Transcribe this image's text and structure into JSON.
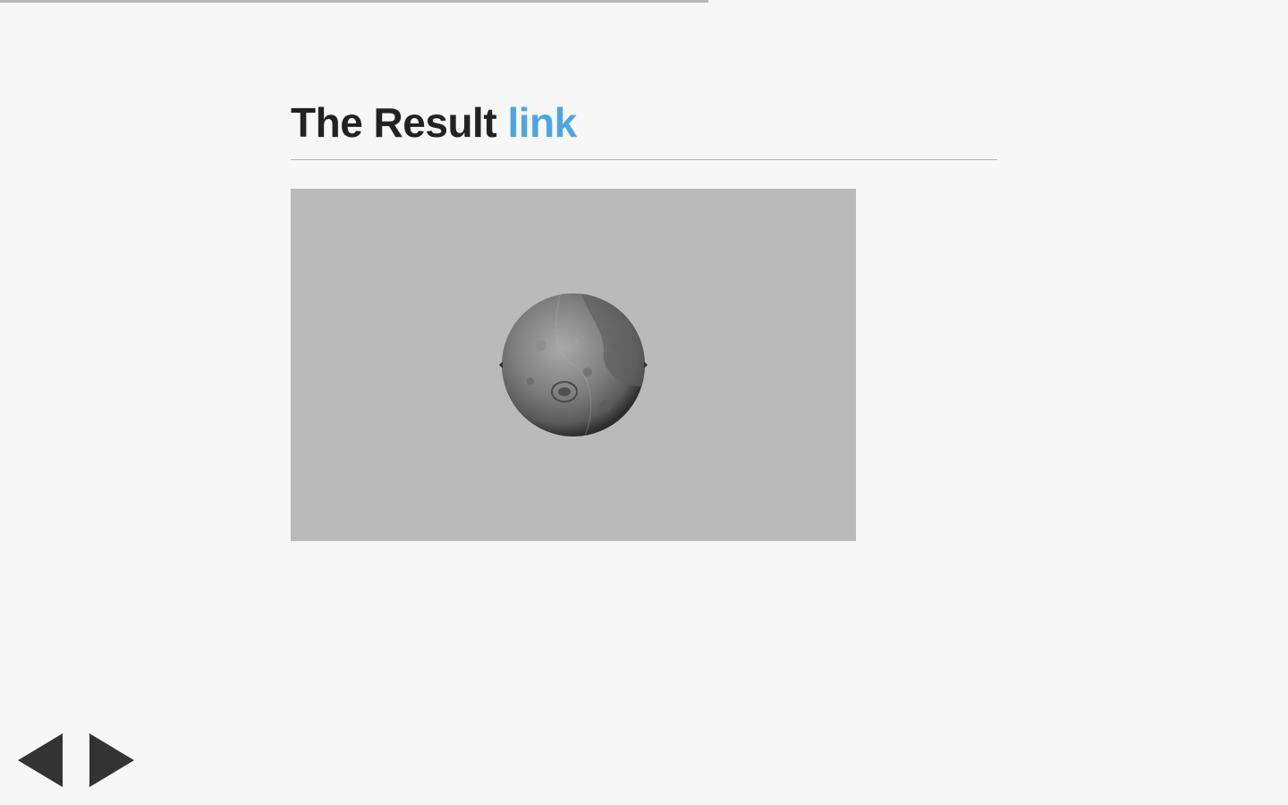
{
  "progress": {
    "fraction": 0.55
  },
  "slide": {
    "title_text": "The Result ",
    "title_link": "link"
  },
  "nav": {
    "prev_icon": "triangle-left-icon",
    "next_icon": "triangle-right-icon"
  },
  "colors": {
    "background": "#f7f7f7",
    "title": "#222222",
    "link": "#4da6df",
    "viewer_bg": "#bababa",
    "nav_arrow": "#333333",
    "progress": "#b8b8b8"
  }
}
